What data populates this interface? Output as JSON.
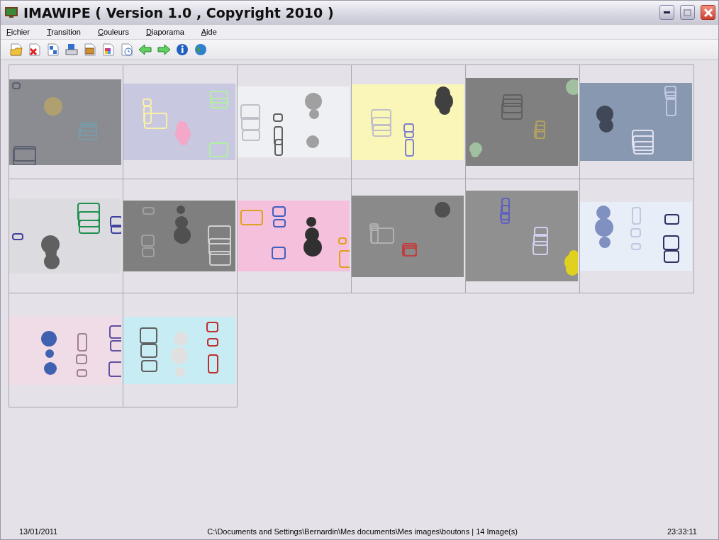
{
  "window": {
    "title": "IMAWIPE ( Version 1.0 , Copyright 2010 )"
  },
  "menu": [
    "Fichier",
    "Transition",
    "Couleurs",
    "Diaporama",
    "Aide"
  ],
  "status_bar": {
    "date": "13/01/2011",
    "path": "C:\\Documents and Settings\\Bernardin\\Mes documents\\Mes images\\boutons | 14 Image(s)",
    "time": "23:33:11"
  }
}
